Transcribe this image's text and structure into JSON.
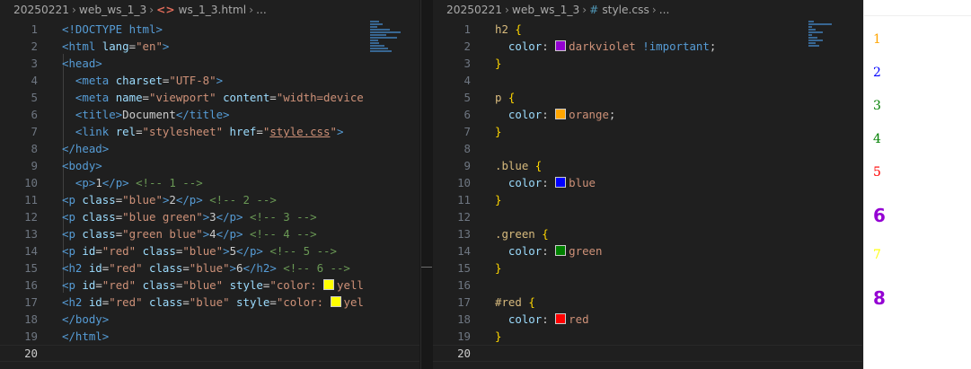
{
  "left_editor": {
    "breadcrumb": {
      "folder": "20250221",
      "subfolder": "web_ws_1_3",
      "icon": "html-file-icon",
      "file": "ws_1_3.html",
      "ellipsis": "..."
    },
    "active_line": 20
  },
  "right_editor": {
    "breadcrumb": {
      "folder": "20250221",
      "subfolder": "web_ws_1_3",
      "icon": "css-hash-icon",
      "file": "style.css",
      "ellipsis": "..."
    },
    "active_line": 20
  },
  "html_code": [
    [
      [
        "tag",
        "<!DOCTYPE "
      ],
      [
        "tag",
        "html"
      ],
      [
        "tag",
        ">"
      ]
    ],
    [
      [
        "tag",
        "<html "
      ],
      [
        "attr",
        "lang"
      ],
      [
        "txt",
        "="
      ],
      [
        "str",
        "\"en\""
      ],
      [
        "tag",
        ">"
      ]
    ],
    [
      [
        "tag",
        "<head>"
      ]
    ],
    [
      [
        "txt",
        "  "
      ],
      [
        "tag",
        "<meta "
      ],
      [
        "attr",
        "charset"
      ],
      [
        "txt",
        "="
      ],
      [
        "str",
        "\"UTF-8\""
      ],
      [
        "tag",
        ">"
      ]
    ],
    [
      [
        "txt",
        "  "
      ],
      [
        "tag",
        "<meta "
      ],
      [
        "attr",
        "name"
      ],
      [
        "txt",
        "="
      ],
      [
        "str",
        "\"viewport\""
      ],
      [
        "txt",
        " "
      ],
      [
        "attr",
        "content"
      ],
      [
        "txt",
        "="
      ],
      [
        "str",
        "\"width=device"
      ]
    ],
    [
      [
        "txt",
        "  "
      ],
      [
        "tag",
        "<title>"
      ],
      [
        "txt",
        "Document"
      ],
      [
        "tag",
        "</title>"
      ]
    ],
    [
      [
        "txt",
        "  "
      ],
      [
        "tag",
        "<link "
      ],
      [
        "attr",
        "rel"
      ],
      [
        "txt",
        "="
      ],
      [
        "str",
        "\"stylesheet\""
      ],
      [
        "txt",
        " "
      ],
      [
        "attr",
        "href"
      ],
      [
        "txt",
        "="
      ],
      [
        "str",
        "\""
      ],
      [
        "link",
        "style.css"
      ],
      [
        "str",
        "\""
      ],
      [
        "tag",
        ">"
      ]
    ],
    [
      [
        "tag",
        "</head>"
      ]
    ],
    [
      [
        "tag",
        "<body>"
      ]
    ],
    [
      [
        "txt",
        "  "
      ],
      [
        "tag",
        "<p>"
      ],
      [
        "txt",
        "1"
      ],
      [
        "tag",
        "</p>"
      ],
      [
        "txt",
        " "
      ],
      [
        "cmt",
        "<!-- 1 -->"
      ]
    ],
    [
      [
        "tag",
        "<p "
      ],
      [
        "attr",
        "class"
      ],
      [
        "txt",
        "="
      ],
      [
        "str",
        "\"blue\""
      ],
      [
        "tag",
        ">"
      ],
      [
        "txt",
        "2"
      ],
      [
        "tag",
        "</p>"
      ],
      [
        "txt",
        " "
      ],
      [
        "cmt",
        "<!-- 2 -->"
      ]
    ],
    [
      [
        "tag",
        "<p "
      ],
      [
        "attr",
        "class"
      ],
      [
        "txt",
        "="
      ],
      [
        "str",
        "\"blue green\""
      ],
      [
        "tag",
        ">"
      ],
      [
        "txt",
        "3"
      ],
      [
        "tag",
        "</p>"
      ],
      [
        "txt",
        " "
      ],
      [
        "cmt",
        "<!-- 3 -->"
      ]
    ],
    [
      [
        "tag",
        "<p "
      ],
      [
        "attr",
        "class"
      ],
      [
        "txt",
        "="
      ],
      [
        "str",
        "\"green blue\""
      ],
      [
        "tag",
        ">"
      ],
      [
        "txt",
        "4"
      ],
      [
        "tag",
        "</p>"
      ],
      [
        "txt",
        " "
      ],
      [
        "cmt",
        "<!-- 4 -->"
      ]
    ],
    [
      [
        "tag",
        "<p "
      ],
      [
        "attr",
        "id"
      ],
      [
        "txt",
        "="
      ],
      [
        "str",
        "\"red\""
      ],
      [
        "txt",
        " "
      ],
      [
        "attr",
        "class"
      ],
      [
        "txt",
        "="
      ],
      [
        "str",
        "\"blue\""
      ],
      [
        "tag",
        ">"
      ],
      [
        "txt",
        "5"
      ],
      [
        "tag",
        "</p>"
      ],
      [
        "txt",
        " "
      ],
      [
        "cmt",
        "<!-- 5 -->"
      ]
    ],
    [
      [
        "tag",
        "<h2 "
      ],
      [
        "attr",
        "id"
      ],
      [
        "txt",
        "="
      ],
      [
        "str",
        "\"red\""
      ],
      [
        "txt",
        " "
      ],
      [
        "attr",
        "class"
      ],
      [
        "txt",
        "="
      ],
      [
        "str",
        "\"blue\""
      ],
      [
        "tag",
        ">"
      ],
      [
        "txt",
        "6"
      ],
      [
        "tag",
        "</h2>"
      ],
      [
        "txt",
        " "
      ],
      [
        "cmt",
        "<!-- 6 -->"
      ]
    ],
    [
      [
        "tag",
        "<p "
      ],
      [
        "attr",
        "id"
      ],
      [
        "txt",
        "="
      ],
      [
        "str",
        "\"red\""
      ],
      [
        "txt",
        " "
      ],
      [
        "attr",
        "class"
      ],
      [
        "txt",
        "="
      ],
      [
        "str",
        "\"blue\""
      ],
      [
        "txt",
        " "
      ],
      [
        "attr",
        "style"
      ],
      [
        "txt",
        "="
      ],
      [
        "str",
        "\"color: "
      ],
      [
        "swatch",
        "#ffff00"
      ],
      [
        "str",
        "yell"
      ]
    ],
    [
      [
        "tag",
        "<h2 "
      ],
      [
        "attr",
        "id"
      ],
      [
        "txt",
        "="
      ],
      [
        "str",
        "\"red\""
      ],
      [
        "txt",
        " "
      ],
      [
        "attr",
        "class"
      ],
      [
        "txt",
        "="
      ],
      [
        "str",
        "\"blue\""
      ],
      [
        "txt",
        " "
      ],
      [
        "attr",
        "style"
      ],
      [
        "txt",
        "="
      ],
      [
        "str",
        "\"color: "
      ],
      [
        "swatch",
        "#ffff00"
      ],
      [
        "str",
        "yel"
      ]
    ],
    [
      [
        "tag",
        "</body>"
      ]
    ],
    [
      [
        "tag",
        "</html>"
      ]
    ],
    []
  ],
  "css_code": [
    [
      [
        "sel",
        "h2 "
      ],
      [
        "brace",
        "{"
      ]
    ],
    [
      [
        "txt",
        "  "
      ],
      [
        "prop",
        "color"
      ],
      [
        "txt",
        ": "
      ],
      [
        "swatch",
        "#9400d3"
      ],
      [
        "str",
        "darkviolet"
      ],
      [
        "txt",
        " "
      ],
      [
        "kw",
        "!important"
      ],
      [
        "txt",
        ";"
      ]
    ],
    [
      [
        "brace",
        "}"
      ]
    ],
    [],
    [
      [
        "sel",
        "p "
      ],
      [
        "brace",
        "{"
      ]
    ],
    [
      [
        "txt",
        "  "
      ],
      [
        "prop",
        "color"
      ],
      [
        "txt",
        ": "
      ],
      [
        "swatch",
        "#ffa500"
      ],
      [
        "str",
        "orange"
      ],
      [
        "txt",
        ";"
      ]
    ],
    [
      [
        "brace",
        "}"
      ]
    ],
    [],
    [
      [
        "sel",
        ".blue "
      ],
      [
        "brace",
        "{"
      ]
    ],
    [
      [
        "txt",
        "  "
      ],
      [
        "prop",
        "color"
      ],
      [
        "txt",
        ": "
      ],
      [
        "swatch",
        "#0000ff"
      ],
      [
        "str",
        "blue"
      ]
    ],
    [
      [
        "brace",
        "}"
      ]
    ],
    [],
    [
      [
        "sel",
        ".green "
      ],
      [
        "brace",
        "{"
      ]
    ],
    [
      [
        "txt",
        "  "
      ],
      [
        "prop",
        "color"
      ],
      [
        "txt",
        ": "
      ],
      [
        "swatch",
        "#008000"
      ],
      [
        "str",
        "green"
      ]
    ],
    [
      [
        "brace",
        "}"
      ]
    ],
    [],
    [
      [
        "sel",
        "#red "
      ],
      [
        "brace",
        "{"
      ]
    ],
    [
      [
        "txt",
        "  "
      ],
      [
        "prop",
        "color"
      ],
      [
        "txt",
        ": "
      ],
      [
        "swatch",
        "#ff0000"
      ],
      [
        "str",
        "red"
      ]
    ],
    [
      [
        "brace",
        "}"
      ]
    ],
    []
  ],
  "preview": {
    "items": [
      {
        "text": "1",
        "tag": "p",
        "color": "#ffa500"
      },
      {
        "text": "2",
        "tag": "p",
        "color": "#0000ff"
      },
      {
        "text": "3",
        "tag": "p",
        "color": "#008000"
      },
      {
        "text": "4",
        "tag": "p",
        "color": "#008000"
      },
      {
        "text": "5",
        "tag": "p",
        "color": "#ff0000"
      },
      {
        "text": "6",
        "tag": "h2",
        "color": "#9400d3"
      },
      {
        "text": "7",
        "tag": "p",
        "color": "#ffff00"
      },
      {
        "text": "8",
        "tag": "h2",
        "color": "#9400d3"
      }
    ]
  },
  "colors": {
    "editor_bg": "#1f1f1f",
    "tag": "#569cd6",
    "attribute": "#9cdcfe",
    "string": "#ce9178",
    "comment": "#6a9955",
    "selector": "#d7ba7d",
    "bracket": "#ffd700"
  }
}
